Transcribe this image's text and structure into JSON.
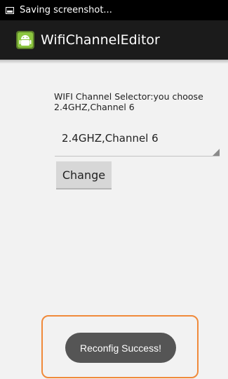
{
  "status_bar": {
    "text": "Saving screenshot..."
  },
  "action_bar": {
    "title": "WifiChannelEditor",
    "icon": "android-app-icon"
  },
  "selector": {
    "label": "WIFI Channel Selector:you choose 2.4GHZ,Channel 6",
    "selected_value": "2.4GHZ,Channel 6"
  },
  "change_button": {
    "label": "Change"
  },
  "toast": {
    "message": "Reconfig Success!"
  },
  "colors": {
    "highlight_border": "#f08a3a",
    "action_bar": "#1b1b1b",
    "toast_bg": "#555555",
    "app_icon_green": "#8cc63f"
  }
}
